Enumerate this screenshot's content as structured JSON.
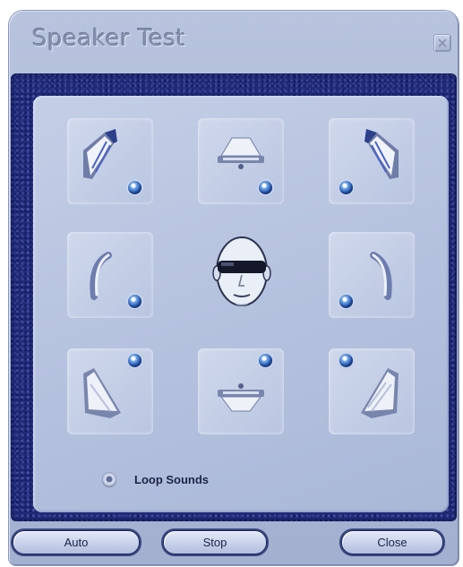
{
  "window": {
    "title": "Speaker Test"
  },
  "icons": {
    "close": "close-x-icon",
    "speakers": [
      "front-left-speaker-icon",
      "center-speaker-icon",
      "front-right-speaker-icon",
      "side-left-speaker-icon",
      "side-right-speaker-icon",
      "rear-left-speaker-icon",
      "subwoofer-speaker-icon",
      "rear-right-speaker-icon"
    ],
    "head": "listener-head-icon"
  },
  "options": {
    "loop_sounds_label": "Loop Sounds"
  },
  "buttons": {
    "auto": "Auto",
    "stop": "Stop",
    "close": "Close"
  },
  "colors": {
    "frame": "#a9b6d4",
    "navy": "#1f2a78",
    "panel": "#b8c4e0",
    "led": "#2a61b8"
  }
}
